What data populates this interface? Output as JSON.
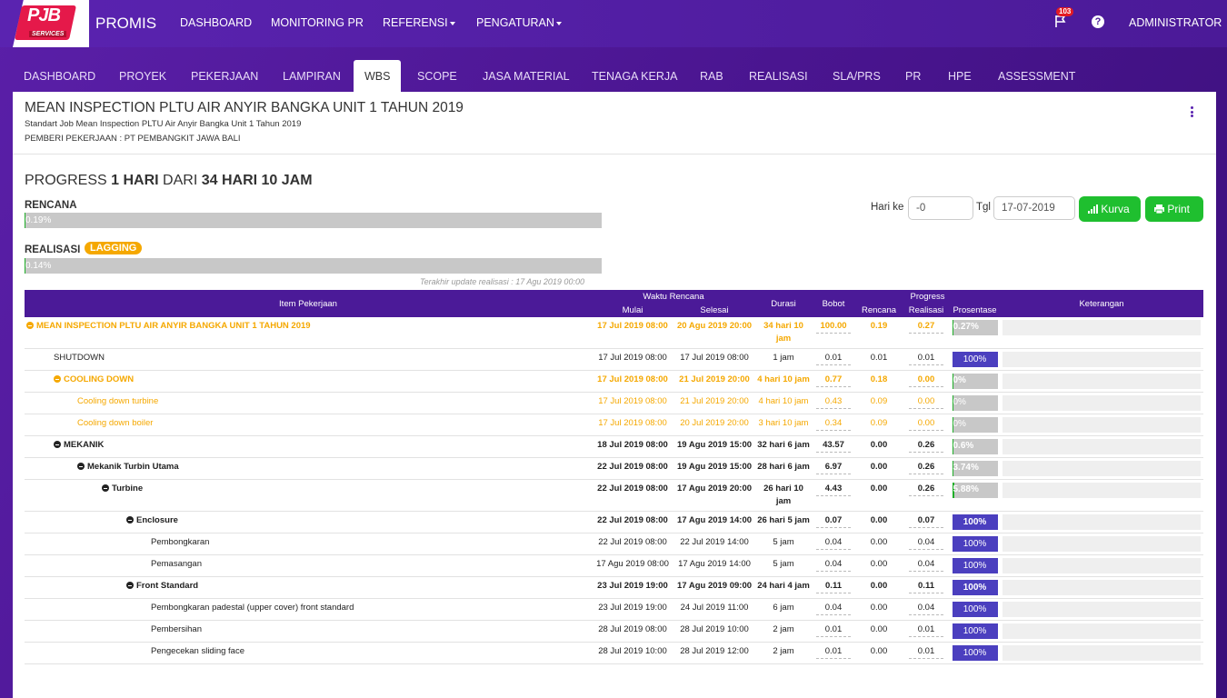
{
  "app": {
    "brand": "PROMIS",
    "logo_text": "PJB",
    "logo_sub": "SERVICES"
  },
  "topnav": [
    "DASHBOARD",
    "MONITORING PR",
    "REFERENSI",
    "PENGATURAN"
  ],
  "notifications": "103",
  "user": "ADMINISTRATOR",
  "tabs": [
    "DASHBOARD",
    "PROYEK",
    "PEKERJAAN",
    "LAMPIRAN",
    "WBS",
    "SCOPE",
    "JASA MATERIAL",
    "TENAGA KERJA",
    "RAB",
    "REALISASI",
    "SLA/PRS",
    "PR",
    "HPE",
    "ASSESSMENT"
  ],
  "active_tab": "WBS",
  "project": {
    "title": "MEAN INSPECTION PLTU AIR ANYIR BANGKA UNIT 1 TAHUN 2019",
    "subtitle": "Standart Job Mean Inspection PLTU Air Anyir Bangka Unit 1 Tahun 2019",
    "owner": "PEMBERI PEKERJAAN : PT PEMBANGKIT JAWA BALI"
  },
  "progress": {
    "prefix": "PROGRESS",
    "current": "1 HARI",
    "mid": "DARI",
    "total": "34 HARI 10 JAM",
    "rencana_label": "RENCANA",
    "rencana_text": "0.19%",
    "rencana_value": 0.19,
    "realisasi_label": "REALISASI",
    "realisasi_text": "0.14%",
    "realisasi_value": 0.14,
    "status": "LAGGING",
    "last_update": "Terakhir update realisasi : 17 Agu 2019 00:00"
  },
  "controls": {
    "hari_ke_label": "Hari ke",
    "hari_ke_value": "-0",
    "tgl_label": "Tgl",
    "tgl_value": "17-07-2019",
    "kurva": "Kurva",
    "print": "Print"
  },
  "table": {
    "headers": {
      "item": "Item Pekerjaan",
      "waktu": "Waktu Rencana",
      "mulai": "Mulai",
      "selesai": "Selesai",
      "durasi": "Durasi",
      "bobot": "Bobot",
      "progress": "Progress",
      "rencana": "Rencana",
      "realisasi": "Realisasi",
      "prosentase": "Prosentase",
      "keterangan": "Keterangan"
    },
    "rows": [
      {
        "level": 0,
        "style": "orange",
        "icon": "minus",
        "name": "MEAN INSPECTION PLTU AIR ANYIR BANGKA UNIT 1 TAHUN 2019",
        "mulai": "17 Jul 2019 08:00",
        "selesai": "20 Agu 2019 20:00",
        "durasi": "34 hari 10 jam",
        "bobot": "100.00",
        "rencana": "0.19",
        "realisasi": "0.27",
        "pct": "0.27%",
        "pct_value": 0.27
      },
      {
        "level": 1,
        "style": "plain",
        "icon": "",
        "name": "SHUTDOWN",
        "mulai": "17 Jul 2019 08:00",
        "selesai": "17 Jul 2019 08:00",
        "durasi": "1 jam",
        "bobot": "0.01",
        "rencana": "0.01",
        "realisasi": "0.01",
        "pct": "100%",
        "pct_value": 100
      },
      {
        "level": 1,
        "style": "orange",
        "icon": "minus",
        "name": "COOLING DOWN",
        "mulai": "17 Jul 2019 08:00",
        "selesai": "21 Jul 2019 20:00",
        "durasi": "4 hari 10 jam",
        "bobot": "0.77",
        "rencana": "0.18",
        "realisasi": "0.00",
        "pct": "0%",
        "pct_value": 0
      },
      {
        "level": 2,
        "style": "orange2",
        "icon": "",
        "name": "Cooling down turbine",
        "mulai": "17 Jul 2019 08:00",
        "selesai": "21 Jul 2019 20:00",
        "durasi": "4 hari 10 jam",
        "bobot": "0.43",
        "rencana": "0.09",
        "realisasi": "0.00",
        "pct": "0%",
        "pct_value": 0
      },
      {
        "level": 2,
        "style": "orange2",
        "icon": "",
        "name": "Cooling down boiler",
        "mulai": "17 Jul 2019 08:00",
        "selesai": "20 Jul 2019 20:00",
        "durasi": "3 hari 10 jam",
        "bobot": "0.34",
        "rencana": "0.09",
        "realisasi": "0.00",
        "pct": "0%",
        "pct_value": 0
      },
      {
        "level": 1,
        "style": "bold",
        "icon": "minus",
        "name": "MEKANIK",
        "mulai": "18 Jul 2019 08:00",
        "selesai": "19 Agu 2019 15:00",
        "durasi": "32 hari 6 jam",
        "bobot": "43.57",
        "rencana": "0.00",
        "realisasi": "0.26",
        "pct": "0.6%",
        "pct_value": 0.6
      },
      {
        "level": 2,
        "style": "bold",
        "icon": "minus",
        "name": "Mekanik Turbin Utama",
        "mulai": "22 Jul 2019 08:00",
        "selesai": "19 Agu 2019 15:00",
        "durasi": "28 hari 6 jam",
        "bobot": "6.97",
        "rencana": "0.00",
        "realisasi": "0.26",
        "pct": "3.74%",
        "pct_value": 3.74
      },
      {
        "level": 3,
        "style": "bold",
        "icon": "minus",
        "name": "Turbine",
        "mulai": "22 Jul 2019 08:00",
        "selesai": "17 Agu 2019 20:00",
        "durasi": "26 hari 10 jam",
        "bobot": "4.43",
        "rencana": "0.00",
        "realisasi": "0.26",
        "pct": "5.88%",
        "pct_value": 5.88
      },
      {
        "level": 4,
        "style": "bold",
        "icon": "minus",
        "name": "Enclosure",
        "mulai": "22 Jul 2019 08:00",
        "selesai": "17 Agu 2019 14:00",
        "durasi": "26 hari 5 jam",
        "bobot": "0.07",
        "rencana": "0.00",
        "realisasi": "0.07",
        "pct": "100%",
        "pct_value": 100
      },
      {
        "level": 5,
        "style": "plain",
        "icon": "",
        "name": "Pembongkaran",
        "mulai": "22 Jul 2019 08:00",
        "selesai": "22 Jul 2019 14:00",
        "durasi": "5 jam",
        "bobot": "0.04",
        "rencana": "0.00",
        "realisasi": "0.04",
        "pct": "100%",
        "pct_value": 100
      },
      {
        "level": 5,
        "style": "plain",
        "icon": "",
        "name": "Pemasangan",
        "mulai": "17 Agu 2019 08:00",
        "selesai": "17 Agu 2019 14:00",
        "durasi": "5 jam",
        "bobot": "0.04",
        "rencana": "0.00",
        "realisasi": "0.04",
        "pct": "100%",
        "pct_value": 100
      },
      {
        "level": 4,
        "style": "bold",
        "icon": "minus",
        "name": "Front Standard",
        "mulai": "23 Jul 2019 19:00",
        "selesai": "17 Agu 2019 09:00",
        "durasi": "24 hari 4 jam",
        "bobot": "0.11",
        "rencana": "0.00",
        "realisasi": "0.11",
        "pct": "100%",
        "pct_value": 100
      },
      {
        "level": 5,
        "style": "plain",
        "icon": "",
        "name": "Pembongkaran padestal (upper cover) front standard",
        "mulai": "23 Jul 2019 19:00",
        "selesai": "24 Jul 2019 11:00",
        "durasi": "6 jam",
        "bobot": "0.04",
        "rencana": "0.00",
        "realisasi": "0.04",
        "pct": "100%",
        "pct_value": 100
      },
      {
        "level": 5,
        "style": "plain",
        "icon": "",
        "name": "Pembersihan",
        "mulai": "28 Jul 2019 08:00",
        "selesai": "28 Jul 2019 10:00",
        "durasi": "2 jam",
        "bobot": "0.01",
        "rencana": "0.00",
        "realisasi": "0.01",
        "pct": "100%",
        "pct_value": 100
      },
      {
        "level": 5,
        "style": "plain",
        "icon": "",
        "name": "Pengecekan sliding face",
        "mulai": "28 Jul 2019 10:00",
        "selesai": "28 Jul 2019 12:00",
        "durasi": "2 jam",
        "bobot": "0.01",
        "rencana": "0.00",
        "realisasi": "0.01",
        "pct": "100%",
        "pct_value": 100
      }
    ]
  }
}
